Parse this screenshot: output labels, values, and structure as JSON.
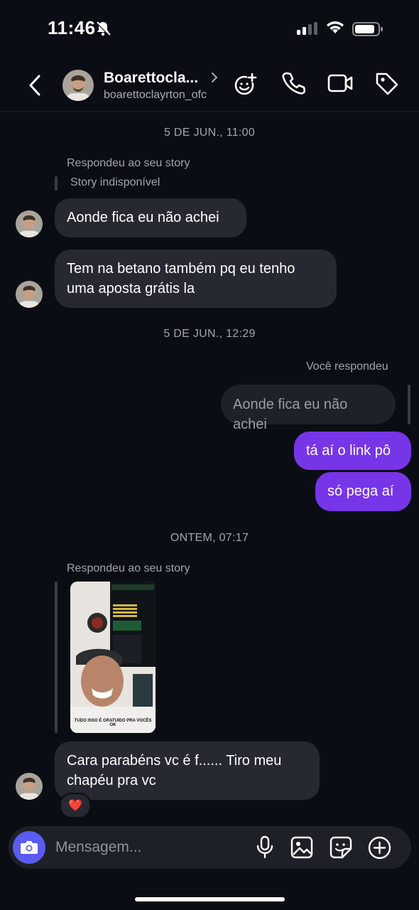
{
  "status_bar": {
    "time": "11:46"
  },
  "header": {
    "name": "Boarettocla...",
    "handle": "boarettoclayrton_ofc"
  },
  "messages": {
    "ts1": "5 DE JUN., 11:00",
    "replied_story_label_1": "Respondeu ao seu story",
    "story_unavailable": "Story indisponível",
    "in1": "Aonde fica eu não achei",
    "in2": "Tem na betano também pq eu tenho uma aposta grátis la",
    "ts2": "5 DE JUN., 12:29",
    "you_replied": "Você respondeu",
    "reply_quote": "Aonde fica eu não achei",
    "out1": "tá aí o link pô",
    "out2": "só pega aí",
    "ts3": "ONTEM, 07:17",
    "replied_story_label_2": "Respondeu ao seu story",
    "story_caption": "TUDO ISSO É GRATUIDO PRA VOCÊS OK",
    "in3": "Cara parabéns vc é f...... Tiro meu chapéu pra vc",
    "reaction": "❤️"
  },
  "composer": {
    "placeholder": "Mensagem..."
  },
  "colors": {
    "background": "#0b0d14",
    "incoming_bubble": "#262931",
    "outgoing_bubble": "#7735e8",
    "camera_button": "#5a5cf0"
  }
}
